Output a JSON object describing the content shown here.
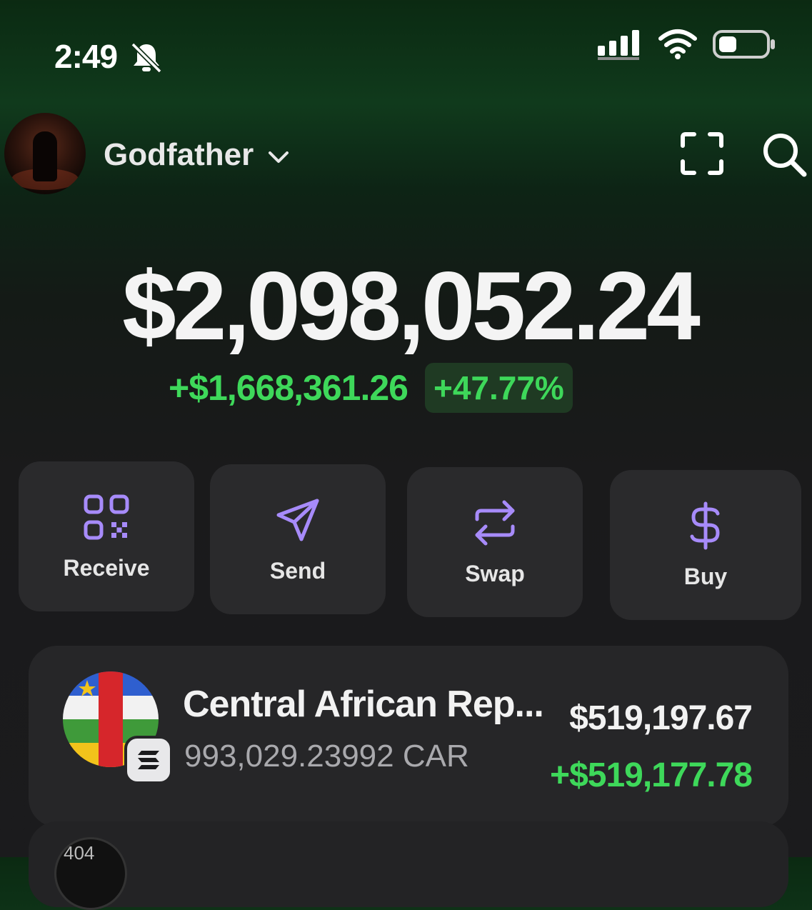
{
  "status_bar": {
    "time": "2:49",
    "icons": [
      "bell-off-icon",
      "signal-icon",
      "wifi-icon",
      "battery-icon"
    ]
  },
  "header": {
    "account_name": "Godfather",
    "icons": [
      "chevron-down-icon",
      "scan-icon",
      "search-icon"
    ]
  },
  "portfolio": {
    "balance": "$2,098,052.24",
    "change_amount": "+$1,668,361.26",
    "change_percent": "+47.77%"
  },
  "actions": [
    {
      "label": "Receive",
      "icon": "qr-code-icon"
    },
    {
      "label": "Send",
      "icon": "send-icon"
    },
    {
      "label": "Swap",
      "icon": "swap-icon"
    },
    {
      "label": "Buy",
      "icon": "dollar-icon"
    }
  ],
  "tokens": [
    {
      "name": "Central African Rep...",
      "amount": "993,029.23992 CAR",
      "value": "$519,197.67",
      "change": "+$519,177.78"
    }
  ],
  "next_token_avatar_text": "404",
  "colors": {
    "positive": "#3ed85a",
    "accent": "#a78bfa",
    "card": "#2a2a2c"
  }
}
